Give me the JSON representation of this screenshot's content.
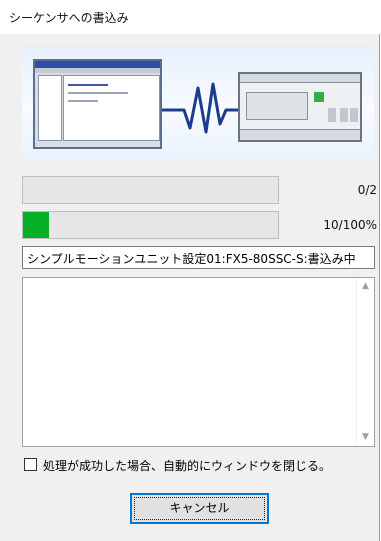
{
  "window": {
    "title": "シーケンサへの書込み"
  },
  "progress": [
    {
      "value_text": "0/2",
      "fraction": 0.0
    },
    {
      "value_text": "10/100%",
      "fraction": 0.1
    }
  ],
  "status_text": "シンプルモーションユニット設定01:FX5-80SSC-S:書込み中",
  "log": {
    "scroll_up_icon": "▲",
    "scroll_down_icon": "▼"
  },
  "options": {
    "auto_close_label": "処理が成功した場合、自動的にウィンドウを閉じる。"
  },
  "buttons": {
    "cancel_label": "キャンセル"
  },
  "colors": {
    "progress_fill": "#06b025",
    "button_focus": "#0078d7"
  }
}
